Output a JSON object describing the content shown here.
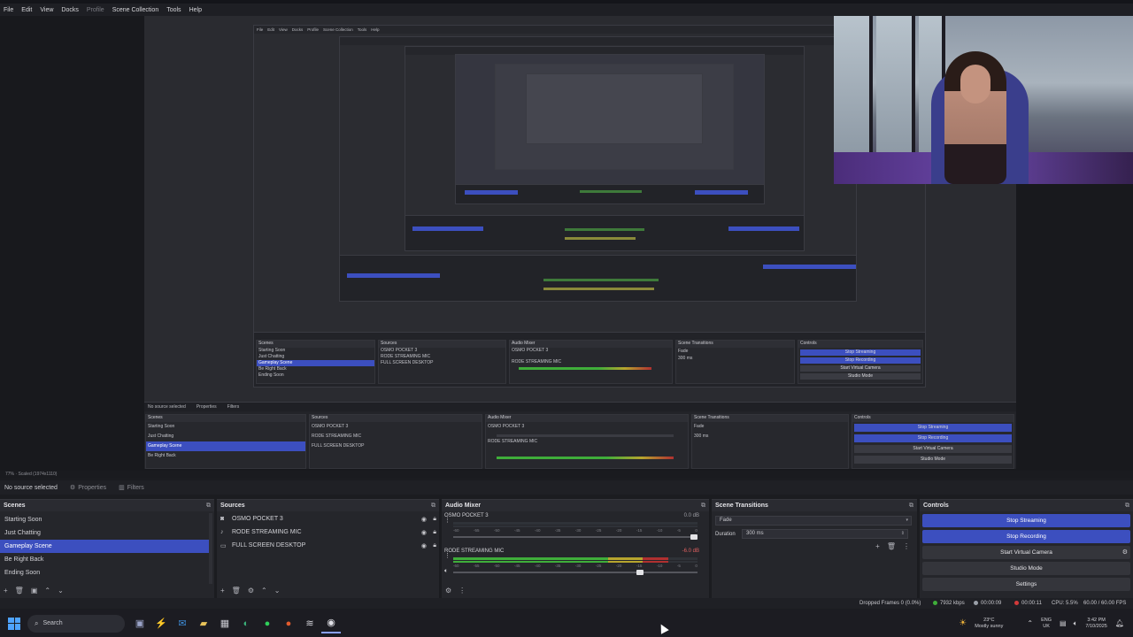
{
  "menu": {
    "items": [
      "File",
      "Edit",
      "View",
      "Docks",
      "Profile",
      "Scene Collection",
      "Tools",
      "Help"
    ]
  },
  "preview": {
    "zoom_text": "77%  ·  Scaled (1974x1110)",
    "nested_menu": [
      "File",
      "Edit",
      "View",
      "Docks",
      "Profile",
      "Scene Collection",
      "Tools",
      "Help"
    ],
    "inner_strip": [
      "No source selected",
      "Properties",
      "Filters"
    ],
    "inner_scenes": [
      "Starting Soon",
      "Just Chatting",
      "Gameplay Scene",
      "Be Right Back",
      "Ending Soon"
    ],
    "inner_sources": [
      "OSMO POCKET 3",
      "RODE STREAMING MIC",
      "FULL SCREEN DESKTOP"
    ],
    "inner_mixer": [
      "OSMO POCKET 3",
      "RODE STREAMING MIC"
    ],
    "inner_transition": [
      "Fade",
      "Duration",
      "300 ms"
    ],
    "inner_controls": [
      "Stop Streaming",
      "Stop Recording",
      "Start Virtual Camera",
      "Studio Mode",
      "Settings"
    ],
    "inner_titles": [
      "Scenes",
      "Sources",
      "Audio Mixer",
      "Scene Transitions",
      "Controls"
    ]
  },
  "propbar": {
    "no_source": "No source selected",
    "properties": "Properties",
    "filters": "Filters"
  },
  "scenes": {
    "title": "Scenes",
    "items": [
      "Starting Soon",
      "Just Chatting",
      "Gameplay Scene",
      "Be Right Back",
      "Ending Soon"
    ],
    "selected_index": 2
  },
  "sources": {
    "title": "Sources",
    "items": [
      "OSMO POCKET 3",
      "RODE STREAMING MIC",
      "FULL SCREEN DESKTOP"
    ]
  },
  "mixer": {
    "title": "Audio Mixer",
    "ticks": [
      "-60",
      "-55",
      "-50",
      "-45",
      "-40",
      "-35",
      "-30",
      "-25",
      "-20",
      "-15",
      "-10",
      "-5",
      "0"
    ],
    "channels": [
      {
        "name": "OSMO POCKET 3",
        "db": "0.0 dB",
        "db_color": "#9b9ca3",
        "level": 0.0,
        "fader": 1.0
      },
      {
        "name": "RODE STREAMING MIC",
        "db": "-6.0 dB",
        "db_color": "#e06060",
        "level": 0.88,
        "fader": 0.78
      }
    ]
  },
  "transitions": {
    "title": "Scene Transitions",
    "type": "Fade",
    "duration_label": "Duration",
    "duration_value": "300 ms"
  },
  "controls": {
    "title": "Controls",
    "stop_streaming": "Stop Streaming",
    "stop_recording": "Stop Recording",
    "start_virtual_camera": "Start Virtual Camera",
    "studio_mode": "Studio Mode",
    "settings": "Settings"
  },
  "status": {
    "dropped": "Dropped Frames 0 (0.0%)",
    "bitrate": "7932 kbps",
    "stream_time": "00:00:09",
    "rec_time": "00:00:11",
    "cpu": "CPU: 5.5%",
    "fps": "60.00 / 60.00 FPS"
  },
  "taskbar": {
    "search": "Search",
    "weather_temp": "23°C",
    "weather_desc": "Mostly sunny",
    "lang_top": "ENG",
    "lang_bottom": "UK",
    "time": "3:42 PM",
    "date": "7/10/2025"
  },
  "colors": {
    "accent": "#3c4fbf",
    "meter_green": "#3fae3a",
    "meter_yellow": "#b7a52e",
    "meter_red": "#b03030"
  }
}
